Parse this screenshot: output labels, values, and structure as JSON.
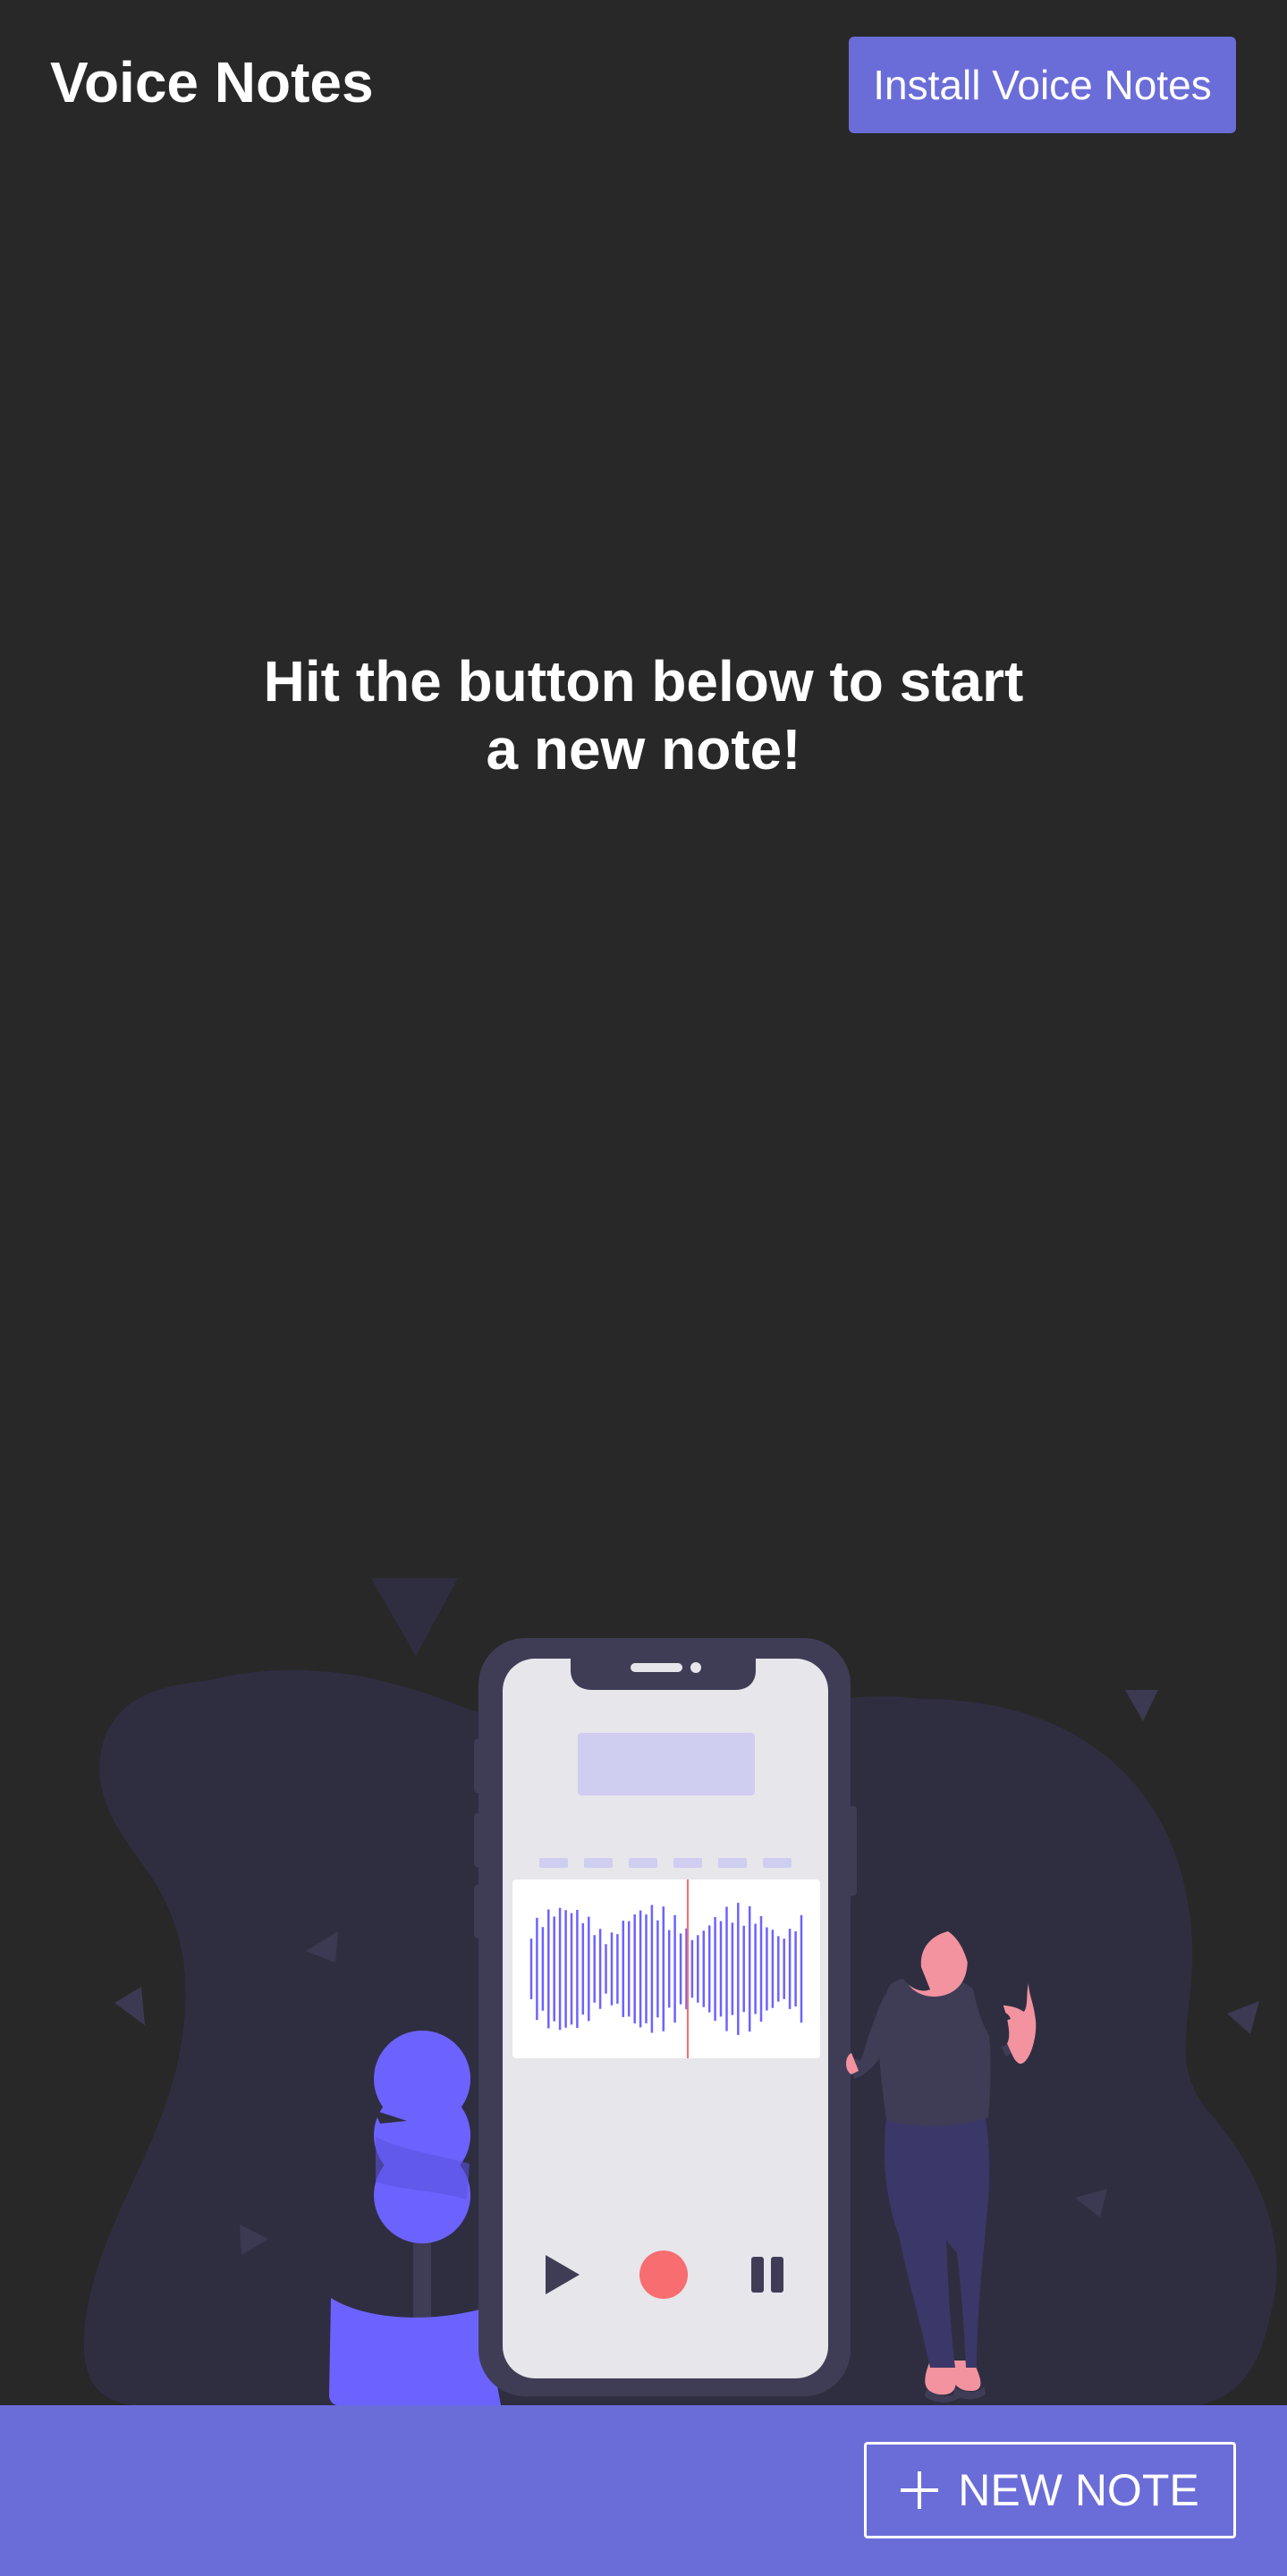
{
  "header": {
    "app_title": "Voice Notes",
    "install_label": "Install Voice Notes"
  },
  "main": {
    "empty_line1": "Hit the button below to start",
    "empty_line2": "a new note!"
  },
  "footer": {
    "new_note_label": "NEW NOTE",
    "new_note_icon": "plus-icon"
  },
  "colors": {
    "background": "#282828",
    "accent": "#6a6dd8",
    "illustration_blob": "#2f2e41",
    "illustration_purple": "#6c63ff",
    "record": "#f86d70"
  }
}
